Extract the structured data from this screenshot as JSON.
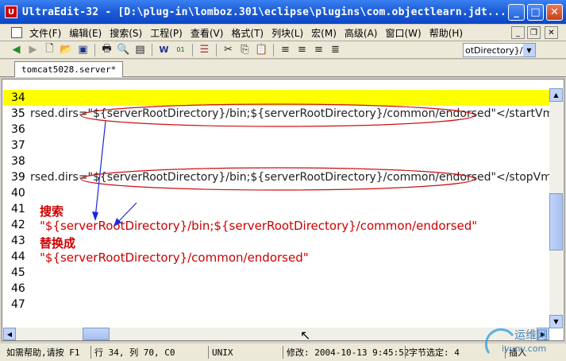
{
  "window": {
    "title": "UltraEdit-32 - [D:\\plug-in\\lomboz.301\\eclipse\\plugins\\com.objectlearn.jdt...",
    "minimize": "_",
    "maximize": "□",
    "close": "✕"
  },
  "menubar": {
    "items": [
      "文件(F)",
      "编辑(E)",
      "搜索(S)",
      "工程(P)",
      "查看(V)",
      "格式(T)",
      "列块(L)",
      "宏(M)",
      "高级(A)",
      "窗口(W)",
      "帮助(H)"
    ]
  },
  "toolbar": {
    "path_select": "otDirectory}/bin"
  },
  "tabs": {
    "active": "tomcat5028.server*"
  },
  "editor": {
    "lines": [
      {
        "num": "34",
        "code": ""
      },
      {
        "num": "35",
        "code": "rsed.dirs=\"${serverRootDirectory}/bin;${serverRootDirectory}/common/endorsed\"</startVmPa"
      },
      {
        "num": "36",
        "code": ""
      },
      {
        "num": "37",
        "code": ""
      },
      {
        "num": "38",
        "code": ""
      },
      {
        "num": "39",
        "code": "rsed.dirs=\"${serverRootDirectory}/bin;${serverRootDirectory}/common/endorsed\"</stopVmPar"
      },
      {
        "num": "40",
        "code": ""
      },
      {
        "num": "41",
        "code": "搜索"
      },
      {
        "num": "42",
        "code": "\"${serverRootDirectory}/bin;${serverRootDirectory}/common/endorsed\""
      },
      {
        "num": "43",
        "code": "替换成"
      },
      {
        "num": "44",
        "code": "\"${serverRootDirectory}/common/endorsed\""
      },
      {
        "num": "45",
        "code": ""
      },
      {
        "num": "46",
        "code": ""
      },
      {
        "num": "47",
        "code": ""
      }
    ]
  },
  "statusbar": {
    "help": "如需帮助,请按 F1",
    "position": "行 34, 列 70, C0",
    "format": "UNIX",
    "modified": "修改: 2004-10-13 9:45:52",
    "selected": "字节选定: 4",
    "mode": "插入"
  },
  "watermark": {
    "text": "运维网",
    "url": "iyunv.com"
  }
}
